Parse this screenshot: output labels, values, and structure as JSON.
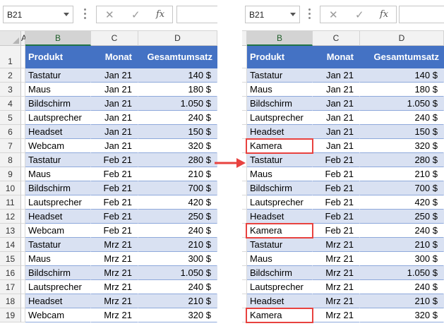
{
  "name_box": "B21",
  "formula_buttons": {
    "cancel": "✕",
    "enter": "✓",
    "fx": "fx"
  },
  "formula_input": "",
  "column_headers": [
    "A",
    "B",
    "C",
    "D"
  ],
  "row_numbers": [
    "1",
    "2",
    "3",
    "4",
    "5",
    "6",
    "7",
    "8",
    "9",
    "10",
    "11",
    "12",
    "13",
    "14",
    "15",
    "16",
    "17",
    "18",
    "19"
  ],
  "table_headers": {
    "product": "Produkt",
    "month": "Monat",
    "total": "Gesamtumsatz"
  },
  "left_rows": [
    [
      "Tastatur",
      "Jan 21",
      "140 $"
    ],
    [
      "Maus",
      "Jan 21",
      "180 $"
    ],
    [
      "Bildschirm",
      "Jan 21",
      "1.050 $"
    ],
    [
      "Lautsprecher",
      "Jan 21",
      "240 $"
    ],
    [
      "Headset",
      "Jan 21",
      "150 $"
    ],
    [
      "Webcam",
      "Jan 21",
      "320 $"
    ],
    [
      "Tastatur",
      "Feb 21",
      "280 $"
    ],
    [
      "Maus",
      "Feb 21",
      "210 $"
    ],
    [
      "Bildschirm",
      "Feb 21",
      "700 $"
    ],
    [
      "Lautsprecher",
      "Feb 21",
      "420 $"
    ],
    [
      "Headset",
      "Feb 21",
      "250 $"
    ],
    [
      "Webcam",
      "Feb 21",
      "240 $"
    ],
    [
      "Tastatur",
      "Mrz 21",
      "210 $"
    ],
    [
      "Maus",
      "Mrz 21",
      "300 $"
    ],
    [
      "Bildschirm",
      "Mrz 21",
      "1.050 $"
    ],
    [
      "Lautsprecher",
      "Mrz 21",
      "240 $"
    ],
    [
      "Headset",
      "Mrz 21",
      "210 $"
    ],
    [
      "Webcam",
      "Mrz 21",
      "320 $"
    ]
  ],
  "right_rows": [
    [
      "Tastatur",
      "Jan 21",
      "140 $"
    ],
    [
      "Maus",
      "Jan 21",
      "180 $"
    ],
    [
      "Bildschirm",
      "Jan 21",
      "1.050 $"
    ],
    [
      "Lautsprecher",
      "Jan 21",
      "240 $"
    ],
    [
      "Headset",
      "Jan 21",
      "150 $"
    ],
    [
      "Kamera",
      "Jan 21",
      "320 $"
    ],
    [
      "Tastatur",
      "Feb 21",
      "280 $"
    ],
    [
      "Maus",
      "Feb 21",
      "210 $"
    ],
    [
      "Bildschirm",
      "Feb 21",
      "700 $"
    ],
    [
      "Lautsprecher",
      "Feb 21",
      "420 $"
    ],
    [
      "Headset",
      "Feb 21",
      "250 $"
    ],
    [
      "Kamera",
      "Feb 21",
      "240 $"
    ],
    [
      "Tastatur",
      "Mrz 21",
      "210 $"
    ],
    [
      "Maus",
      "Mrz 21",
      "300 $"
    ],
    [
      "Bildschirm",
      "Mrz 21",
      "1.050 $"
    ],
    [
      "Lautsprecher",
      "Mrz 21",
      "240 $"
    ],
    [
      "Headset",
      "Mrz 21",
      "210 $"
    ],
    [
      "Kamera",
      "Mrz 21",
      "320 $"
    ]
  ],
  "highlighted_rows": [
    6,
    12,
    18
  ],
  "colors": {
    "table_header": "#4472c4",
    "band": "#d9e1f2",
    "highlight": "#e8423f",
    "arrow": "#e8423f",
    "selected_column_header": "#d3d3d3"
  },
  "icons": {
    "arrow": "right-arrow-icon",
    "namebox_dropdown": "chevron-down-icon"
  }
}
